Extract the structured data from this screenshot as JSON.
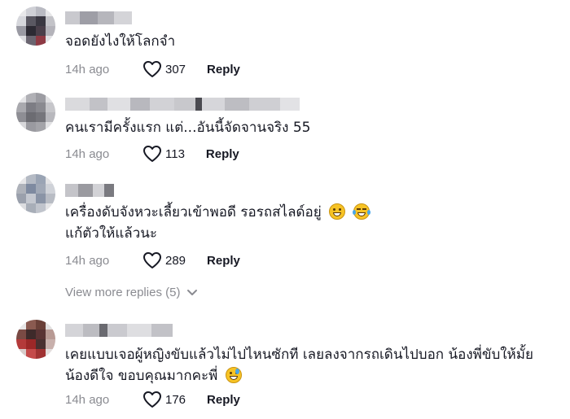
{
  "comments": [
    {
      "text_lines": [
        "จอดยังไงให้โลกจำ"
      ],
      "time": "14h ago",
      "likes": "307",
      "reply_label": "Reply"
    },
    {
      "text_lines": [
        "คนเรามีครั้งแรก แต่...อันนี้จัดจานจริง 55"
      ],
      "time": "14h ago",
      "likes": "113",
      "reply_label": "Reply"
    },
    {
      "text_lines": [
        "เครื่องดับจังหวะเลี้ยวเข้าพอดี รอรถสไลด์อยู่",
        "แก้ตัวให้แล้วนะ"
      ],
      "time": "14h ago",
      "likes": "289",
      "reply_label": "Reply",
      "emojis": [
        "grinning-face-icon",
        "laughing-tears-icon"
      ]
    },
    {
      "text_lines": [
        "เคยแบบเจอผู้หญิงขับแล้วไม่ไปไหนซักที เลยลงจากรถเดินไปบอก น้องพี่ขับให้มั้ย",
        "น้องดีใจ ขอบคุณมากคะพี่"
      ],
      "time": "14h ago",
      "likes": "176",
      "reply_label": "Reply",
      "emojis": [
        "sweat-smile-icon"
      ]
    }
  ],
  "view_more": "View more replies (5)",
  "colors": {
    "text": "#161823",
    "muted": "#8a8b91",
    "background": "#ffffff"
  }
}
